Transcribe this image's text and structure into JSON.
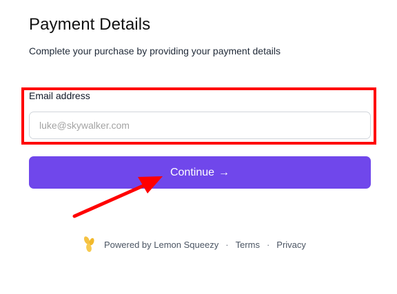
{
  "header": {
    "title": "Payment Details",
    "subtitle": "Complete your purchase by providing your payment details"
  },
  "form": {
    "email_label": "Email address",
    "email_placeholder": "luke@skywalker.com",
    "email_value": "",
    "continue_label": "Continue",
    "continue_arrow": "→"
  },
  "footer": {
    "powered_by": "Powered by Lemon Squeezy",
    "separator": "·",
    "terms": "Terms",
    "privacy": "Privacy",
    "logo_icon": "lemon-squeezy-logo-icon"
  },
  "colors": {
    "accent": "#7047eb",
    "highlight": "#ff0000",
    "logo": "#f5c242"
  }
}
